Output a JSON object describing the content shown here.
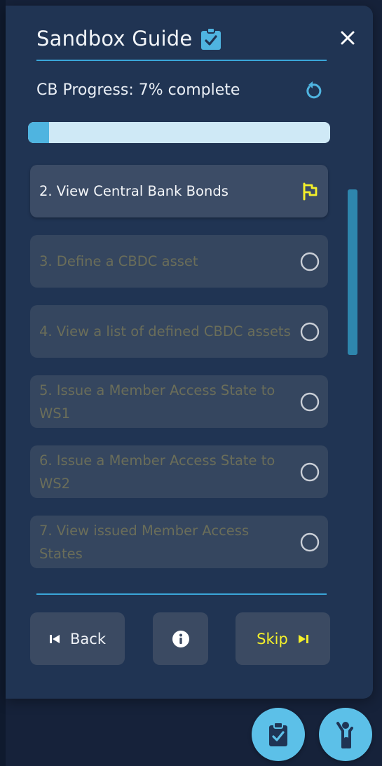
{
  "guide": {
    "title": "Sandbox Guide",
    "title_icon": "clipboard-check-icon",
    "close_icon": "close-icon"
  },
  "progress": {
    "label": "CB Progress: 7% complete",
    "value": 0.07,
    "reset_icon": "reset-icon"
  },
  "steps": [
    {
      "label": "2. View Central Bank Bonds",
      "status": "current",
      "icon": "flag-icon"
    },
    {
      "label": "3. Define a CBDC asset",
      "status": "pending",
      "icon": "circle-icon"
    },
    {
      "label": "4. View a list of defined CBDC assets",
      "status": "pending",
      "icon": "circle-icon"
    },
    {
      "label": "5. Issue a Member Access State to WS1",
      "status": "pending",
      "icon": "circle-icon"
    },
    {
      "label": "6. Issue a Member Access State to WS2",
      "status": "pending",
      "icon": "circle-icon"
    },
    {
      "label": "7. View issued Member Access States",
      "status": "pending",
      "icon": "circle-icon"
    }
  ],
  "buttons": {
    "back_label": "Back",
    "skip_label": "Skip",
    "info_icon": "info-icon"
  },
  "colors": {
    "panel": "#203453",
    "accent": "#3aa6d8",
    "flag": "#f4f02a",
    "fab": "#5cc0e8"
  },
  "fabs": {
    "guide_icon": "clipboard-check-icon",
    "person_icon": "person-icon"
  }
}
